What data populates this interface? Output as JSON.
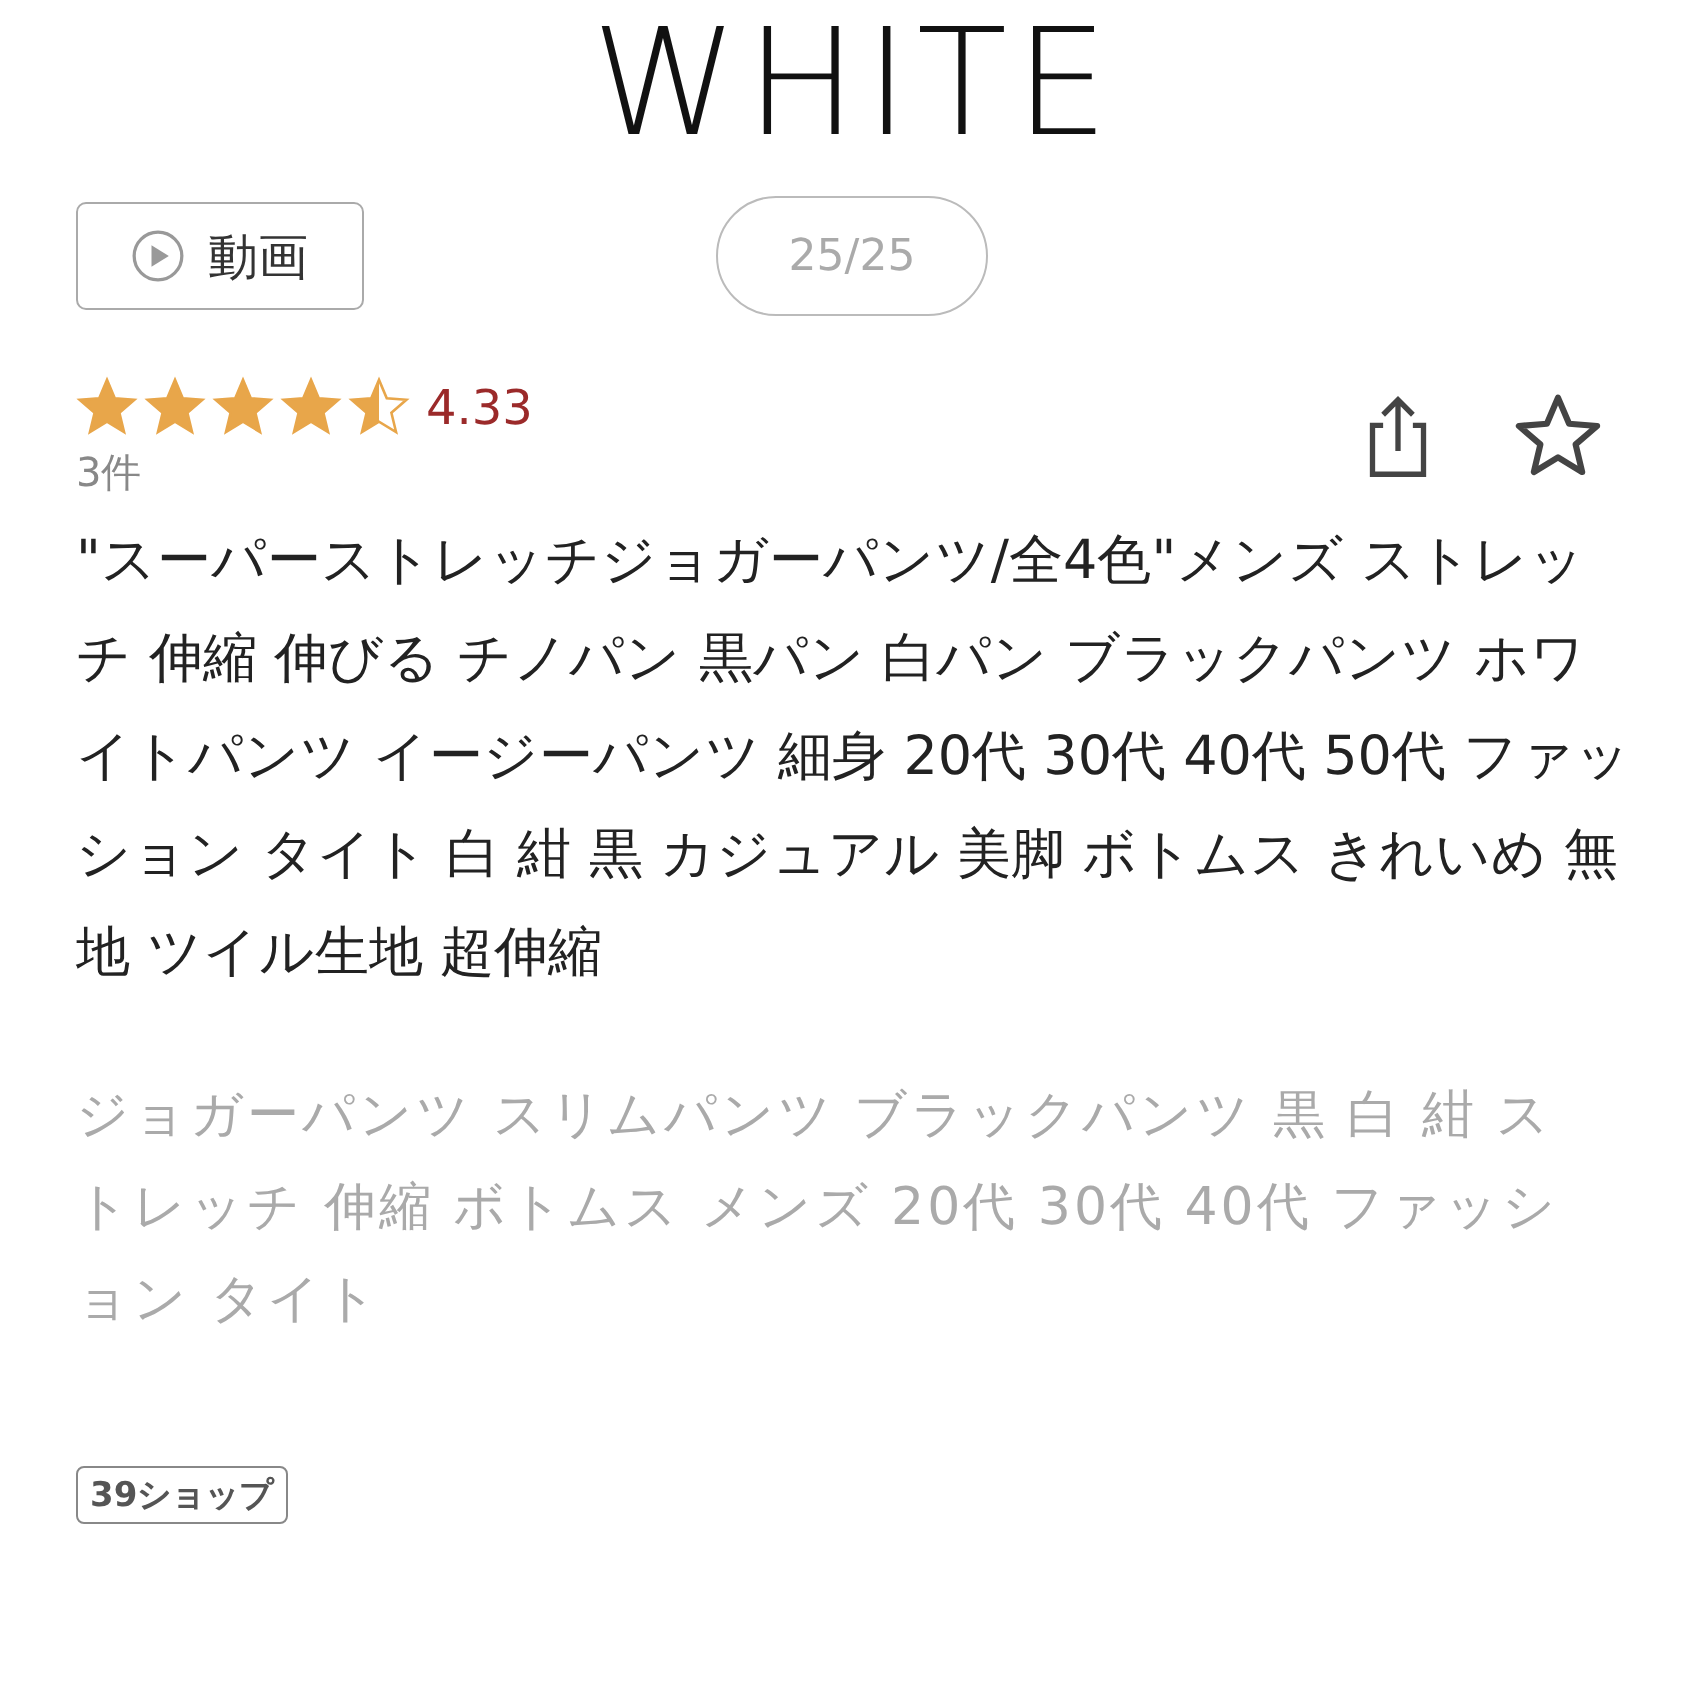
{
  "brand": "WHITE",
  "video_button": {
    "label": "動画"
  },
  "counter": "25/25",
  "rating": {
    "stars": 4.5,
    "score": "4.33",
    "count": "3件"
  },
  "title": "\"スーパーストレッチジョガーパンツ/全4色\"メンズ ストレッチ 伸縮 伸びる チノパン 黒パン 白パン ブラックパンツ ホワイトパンツ イージーパンツ 細身 20代 30代 40代 50代 ファッション タイト 白 紺 黒 カジュアル 美脚 ボトムス きれいめ 無地 ツイル生地 超伸縮",
  "description": "ジョガーパンツ スリムパンツ ブラックパンツ 黒 白 紺 ストレッチ 伸縮 ボトムス メンズ 20代 30代 40代 ファッション タイト",
  "tags": [
    "39ショップ"
  ]
}
